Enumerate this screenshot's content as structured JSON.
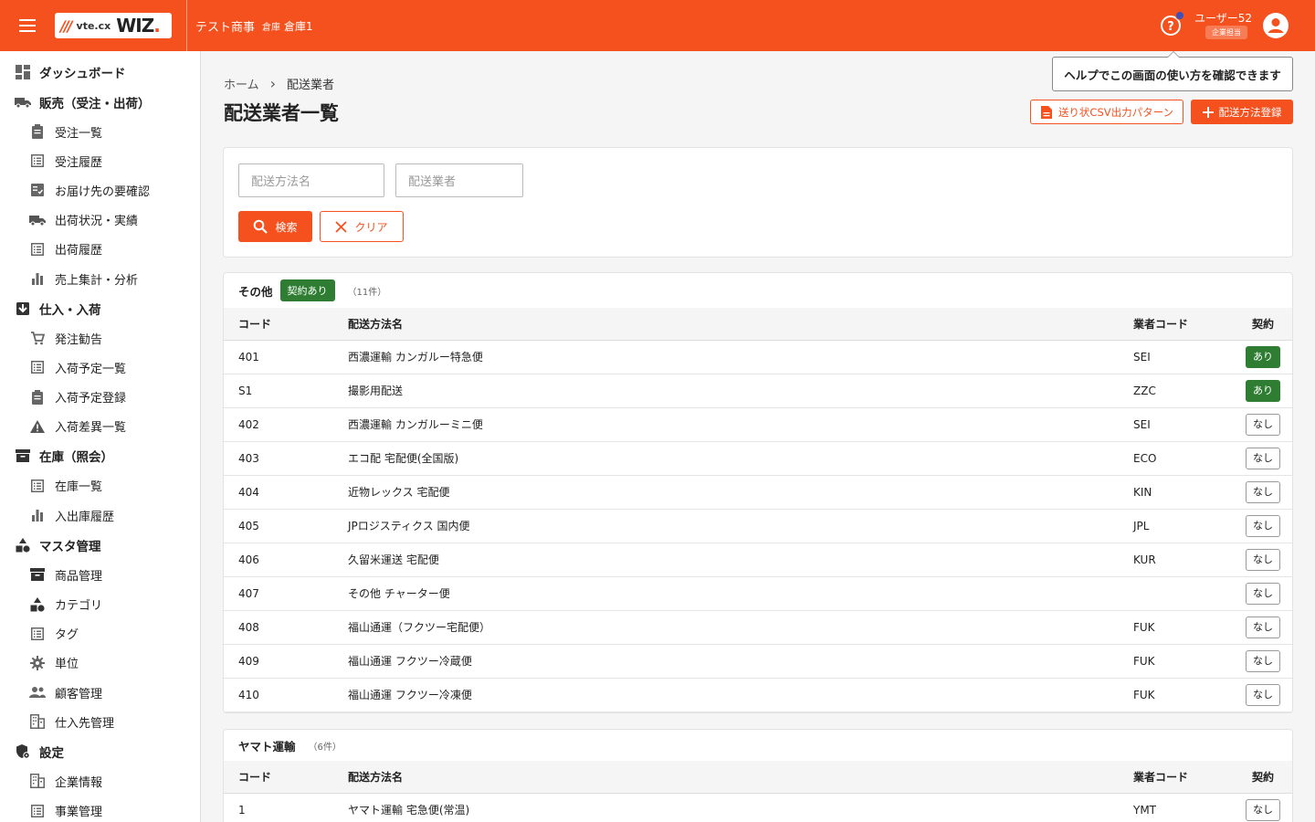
{
  "header": {
    "logo_small": "vte.cx",
    "logo_big": "WIZ",
    "logo_dot": ".",
    "company": "テスト商事",
    "warehouse_label": "倉庫",
    "warehouse_name": "倉庫1",
    "user_name": "ユーザー52",
    "user_role": "企業担当",
    "accent": "#f4511e"
  },
  "tooltip": "ヘルプでこの画面の使い方を確認できます",
  "sidebar": [
    {
      "label": "ダッシュボード",
      "level": "top",
      "icon": "dashboard-icon"
    },
    {
      "label": "販売（受注・出荷）",
      "level": "top",
      "icon": "truck-icon"
    },
    {
      "label": "受注一覧",
      "level": "sub",
      "icon": "clipboard-icon"
    },
    {
      "label": "受注履歴",
      "level": "sub",
      "icon": "list-icon"
    },
    {
      "label": "お届け先の要確認",
      "level": "sub",
      "icon": "checklist-icon"
    },
    {
      "label": "出荷状況・実績",
      "level": "sub",
      "icon": "truck-icon"
    },
    {
      "label": "出荷履歴",
      "level": "sub",
      "icon": "list-icon"
    },
    {
      "label": "売上集計・分析",
      "level": "sub",
      "icon": "bar-chart-icon"
    },
    {
      "label": "仕入・入荷",
      "level": "top",
      "icon": "inbox-icon"
    },
    {
      "label": "発注勧告",
      "level": "sub",
      "icon": "cart-icon"
    },
    {
      "label": "入荷予定一覧",
      "level": "sub",
      "icon": "list-icon"
    },
    {
      "label": "入荷予定登録",
      "level": "sub",
      "icon": "clipboard-icon"
    },
    {
      "label": "入荷差異一覧",
      "level": "sub",
      "icon": "warning-icon"
    },
    {
      "label": "在庫（照会）",
      "level": "top",
      "icon": "archive-icon"
    },
    {
      "label": "在庫一覧",
      "level": "sub",
      "icon": "list-icon"
    },
    {
      "label": "入出庫履歴",
      "level": "sub",
      "icon": "bar-chart-icon"
    },
    {
      "label": "マスタ管理",
      "level": "top",
      "icon": "shapes-icon"
    },
    {
      "label": "商品管理",
      "level": "sub",
      "icon": "archive-icon"
    },
    {
      "label": "カテゴリ",
      "level": "sub",
      "icon": "shapes-icon"
    },
    {
      "label": "タグ",
      "level": "sub",
      "icon": "list-icon"
    },
    {
      "label": "単位",
      "level": "sub",
      "icon": "gear-icon"
    },
    {
      "label": "顧客管理",
      "level": "sub",
      "icon": "people-icon"
    },
    {
      "label": "仕入先管理",
      "level": "sub",
      "icon": "building-icon"
    },
    {
      "label": "設定",
      "level": "top",
      "icon": "shield-gear-icon"
    },
    {
      "label": "企業情報",
      "level": "sub",
      "icon": "building-icon"
    },
    {
      "label": "事業管理",
      "level": "sub",
      "icon": "list-icon"
    }
  ],
  "breadcrumb": {
    "home": "ホーム",
    "separator": "›",
    "current": "配送業者"
  },
  "page_title": "配送業者一覧",
  "actions": {
    "csv_label": "送り状CSV出力パターン",
    "add_label": "配送方法登録"
  },
  "search": {
    "method_placeholder": "配送方法名",
    "carrier_placeholder": "配送業者",
    "search_label": "検索",
    "clear_label": "クリア"
  },
  "columns": {
    "code": "コード",
    "method": "配送方法名",
    "carrier_code": "業者コード",
    "contract": "契約"
  },
  "group1": {
    "name": "その他",
    "badge": "契約あり",
    "count": "（11件）",
    "rows": [
      {
        "code": "401",
        "method": "西濃運輸 カンガルー特急便",
        "carrier": "SEI",
        "contract": "あり"
      },
      {
        "code": "S1",
        "method": "撮影用配送",
        "carrier": "ZZC",
        "contract": "あり"
      },
      {
        "code": "402",
        "method": "西濃運輸 カンガルーミニ便",
        "carrier": "SEI",
        "contract": "なし"
      },
      {
        "code": "403",
        "method": "エコ配 宅配便(全国版)",
        "carrier": "ECO",
        "contract": "なし"
      },
      {
        "code": "404",
        "method": "近物レックス 宅配便",
        "carrier": "KIN",
        "contract": "なし"
      },
      {
        "code": "405",
        "method": "JPロジスティクス 国内便",
        "carrier": "JPL",
        "contract": "なし"
      },
      {
        "code": "406",
        "method": "久留米運送 宅配便",
        "carrier": "KUR",
        "contract": "なし"
      },
      {
        "code": "407",
        "method": "その他 チャーター便",
        "carrier": "",
        "contract": "なし"
      },
      {
        "code": "408",
        "method": "福山通運（フクツー宅配便）",
        "carrier": "FUK",
        "contract": "なし"
      },
      {
        "code": "409",
        "method": "福山通運 フクツー冷蔵便",
        "carrier": "FUK",
        "contract": "なし"
      },
      {
        "code": "410",
        "method": "福山通運 フクツー冷凍便",
        "carrier": "FUK",
        "contract": "なし"
      }
    ]
  },
  "group2": {
    "name": "ヤマト運輸",
    "count": "（6件）",
    "rows": [
      {
        "code": "1",
        "method": "ヤマト運輸 宅急便(常温)",
        "carrier": "YMT",
        "contract": "なし"
      }
    ]
  }
}
